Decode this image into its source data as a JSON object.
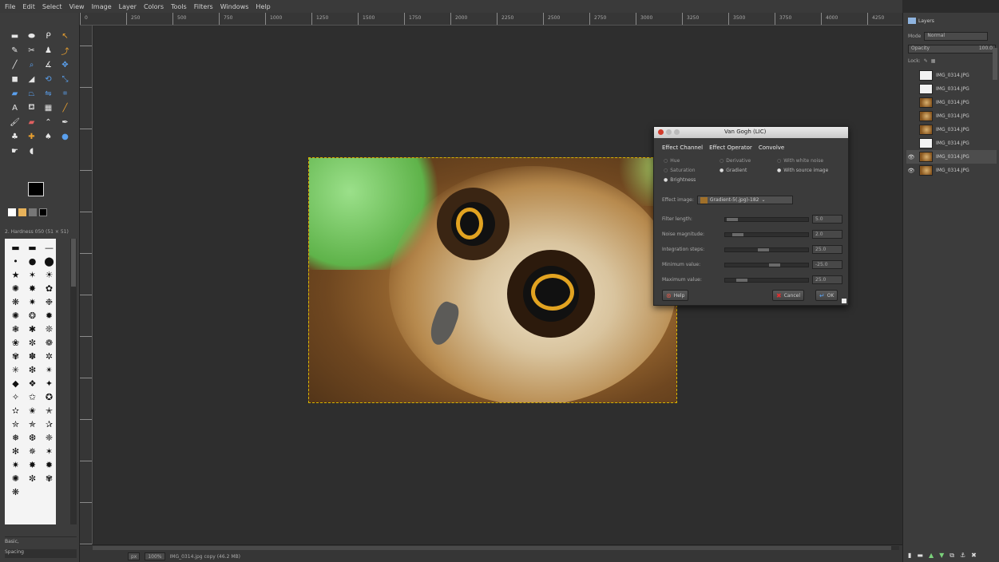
{
  "app": {
    "menu": [
      "File",
      "Edit",
      "Select",
      "View",
      "Image",
      "Layer",
      "Colors",
      "Tools",
      "Filters",
      "Windows",
      "Help"
    ]
  },
  "ruler": {
    "ticks": [
      "0",
      "250",
      "500",
      "750",
      "1000",
      "1250",
      "1500",
      "1750",
      "2000",
      "2250",
      "2500",
      "2750",
      "3000",
      "3250",
      "3500",
      "3750",
      "4000",
      "4250"
    ]
  },
  "toolbox": {
    "tools": [
      {
        "icon": "rect-select-icon",
        "glyph": "▬",
        "tone": ""
      },
      {
        "icon": "ellipse-select-icon",
        "glyph": "⬬",
        "tone": ""
      },
      {
        "icon": "lasso-icon",
        "glyph": "ᑭ",
        "tone": ""
      },
      {
        "icon": "fuzzy-select-icon",
        "glyph": "↖",
        "tone": "orange"
      },
      {
        "icon": "color-select-icon",
        "glyph": "✎",
        "tone": ""
      },
      {
        "icon": "scissors-icon",
        "glyph": "✂",
        "tone": ""
      },
      {
        "icon": "foreground-select-icon",
        "glyph": "♟",
        "tone": ""
      },
      {
        "icon": "paths-icon",
        "glyph": "⤴",
        "tone": "orange"
      },
      {
        "icon": "color-picker-icon",
        "glyph": "╱",
        "tone": ""
      },
      {
        "icon": "zoom-icon",
        "glyph": "⌕",
        "tone": "blue"
      },
      {
        "icon": "measure-icon",
        "glyph": "∡",
        "tone": ""
      },
      {
        "icon": "move-icon",
        "glyph": "✥",
        "tone": "blue"
      },
      {
        "icon": "align-icon",
        "glyph": "◼",
        "tone": ""
      },
      {
        "icon": "crop-icon",
        "glyph": "◢",
        "tone": ""
      },
      {
        "icon": "rotate-icon",
        "glyph": "⟲",
        "tone": "blue"
      },
      {
        "icon": "scale-icon",
        "glyph": "⤡",
        "tone": "blue"
      },
      {
        "icon": "shear-icon",
        "glyph": "▰",
        "tone": "blue"
      },
      {
        "icon": "perspective-icon",
        "glyph": "⏢",
        "tone": "blue"
      },
      {
        "icon": "flip-icon",
        "glyph": "⇋",
        "tone": "blue"
      },
      {
        "icon": "cage-icon",
        "glyph": "⌗",
        "tone": "blue"
      },
      {
        "icon": "text-icon",
        "glyph": "A",
        "tone": ""
      },
      {
        "icon": "bucket-fill-icon",
        "glyph": "⛾",
        "tone": ""
      },
      {
        "icon": "blend-icon",
        "glyph": "▦",
        "tone": ""
      },
      {
        "icon": "pencil-icon",
        "glyph": "╱",
        "tone": "orange"
      },
      {
        "icon": "paintbrush-icon",
        "glyph": "🖌",
        "tone": ""
      },
      {
        "icon": "eraser-icon",
        "glyph": "▰",
        "tone": "red"
      },
      {
        "icon": "airbrush-icon",
        "glyph": "⌃",
        "tone": ""
      },
      {
        "icon": "ink-icon",
        "glyph": "✒",
        "tone": ""
      },
      {
        "icon": "clone-icon",
        "glyph": "♣",
        "tone": ""
      },
      {
        "icon": "heal-icon",
        "glyph": "✚",
        "tone": "orange"
      },
      {
        "icon": "perspective-clone-icon",
        "glyph": "♠",
        "tone": ""
      },
      {
        "icon": "blur-icon",
        "glyph": "●",
        "tone": "blue"
      },
      {
        "icon": "smudge-icon",
        "glyph": "☛",
        "tone": ""
      },
      {
        "icon": "dodge-burn-icon",
        "glyph": "◖",
        "tone": ""
      }
    ],
    "brush_label": "2. Hardness 050 (51 × 51)",
    "brushes": [
      "▬",
      "▬",
      "—",
      "•",
      "●",
      "⬤",
      "★",
      "✶",
      "☀",
      "✺",
      "✸",
      "✿",
      "❋",
      "✷",
      "❉",
      "✺",
      "❂",
      "✹",
      "❃",
      "✱",
      "❊",
      "❀",
      "✼",
      "❁",
      "✾",
      "✽",
      "✲",
      "✳",
      "❇",
      "✴",
      "◆",
      "❖",
      "✦",
      "✧",
      "✩",
      "✪",
      "✫",
      "✬",
      "✭",
      "✮",
      "✯",
      "✰",
      "❅",
      "❆",
      "❈",
      "✻",
      "✵",
      "✶",
      "✷",
      "✸",
      "✹",
      "✺",
      "✼",
      "✾",
      "❋"
    ],
    "mode_label": "Basic,",
    "spacing_label": "Spacing"
  },
  "dialog": {
    "title": "Van Gogh (LIC)",
    "tabs": [
      "Effect Channel",
      "Effect Operator",
      "Convolve"
    ],
    "radios": [
      {
        "label": "Hue",
        "on": false
      },
      {
        "label": "Derivative",
        "on": false
      },
      {
        "label": "With white noise",
        "on": false
      },
      {
        "label": "Saturation",
        "on": false
      },
      {
        "label": "Gradient",
        "on": true
      },
      {
        "label": "With source image",
        "on": true
      },
      {
        "label": "Brightness",
        "on": true
      }
    ],
    "mask_label": "Effect image:",
    "mask_value": "Gradient-5(.jpg)-182",
    "sliders": [
      {
        "label": "Filter length:",
        "value": "5.0",
        "knob": 0.02
      },
      {
        "label": "Noise magnitude:",
        "value": "2.0",
        "knob": 0.1
      },
      {
        "label": "Integration steps:",
        "value": "25.0",
        "knob": 0.45
      },
      {
        "label": "Minimum value:",
        "value": "-25.0",
        "knob": 0.6
      },
      {
        "label": "Maximum value:",
        "value": "25.0",
        "knob": 0.15
      }
    ],
    "help_label": "Help",
    "cancel_label": "Cancel",
    "ok_label": "OK"
  },
  "layers_panel": {
    "tab_label": "Layers",
    "mode_label": "Mode",
    "mode_value": "Normal",
    "opacity_label": "Opacity",
    "opacity_value": "100.0",
    "lock_label": "Lock:",
    "layers": [
      {
        "name": "IMG_0314.JPG",
        "thumb": "white",
        "eye": false,
        "selected": false
      },
      {
        "name": "IMG_0314.JPG",
        "thumb": "white",
        "eye": false,
        "selected": false
      },
      {
        "name": "IMG_0314.JPG",
        "thumb": "owl",
        "eye": false,
        "selected": false
      },
      {
        "name": "IMG_0314.JPG",
        "thumb": "owl",
        "eye": false,
        "selected": false
      },
      {
        "name": "IMG_0314.JPG",
        "thumb": "owl",
        "eye": false,
        "selected": false
      },
      {
        "name": "IMG_0314.JPG",
        "thumb": "white",
        "eye": false,
        "selected": false
      },
      {
        "name": "IMG_0314.JPG",
        "thumb": "owl",
        "eye": true,
        "selected": true
      },
      {
        "name": "IMG_0314.JPG",
        "thumb": "owl",
        "eye": true,
        "selected": false
      }
    ]
  },
  "status": {
    "unit": "px",
    "zoom": "100%",
    "info": "IMG_0314.jpg copy (46.2 MB)"
  }
}
